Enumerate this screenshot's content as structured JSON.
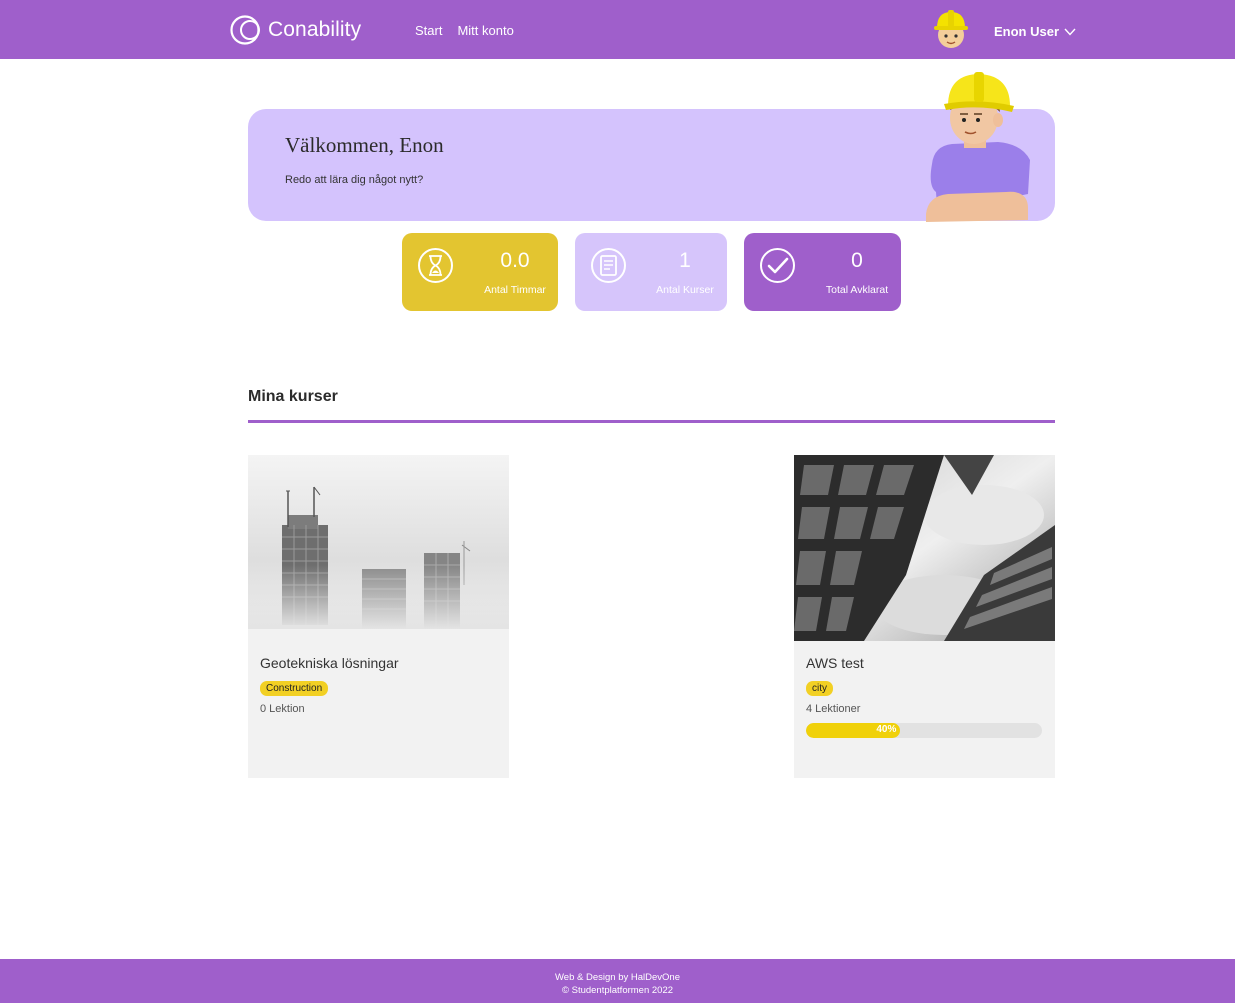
{
  "header": {
    "brand": "Conability",
    "nav": [
      "Start",
      "Mitt konto"
    ],
    "user_name": "Enon User",
    "avatar_icon": "construction-worker-avatar",
    "dropdown_icon": "chevron-down-icon"
  },
  "welcome": {
    "title": "Välkommen, Enon",
    "subtitle": "Redo att lära dig något nytt?"
  },
  "stats": [
    {
      "value": "0.0",
      "label": "Antal Timmar",
      "icon": "hourglass-icon",
      "color": "#e3c530"
    },
    {
      "value": "1",
      "label": "Antal Kurser",
      "icon": "book-icon",
      "color": "#d6c5fb"
    },
    {
      "value": "0",
      "label": "Total Avklarat",
      "icon": "checkmark-icon",
      "color": "#9f5fcb"
    }
  ],
  "section": {
    "title": "Mina kurser"
  },
  "courses": [
    {
      "title": "Geotekniska lösningar",
      "tag": "Construction",
      "lessons": "0 Lektion",
      "image": "foggy-construction-skyline"
    },
    {
      "title": "AWS test",
      "tag": "city",
      "lessons": "4 Lektioner",
      "progress": 0.4,
      "progress_label": "40%",
      "image": "skyscraper-low-angle"
    }
  ],
  "footer": {
    "line1": "Web & Design by HalDevOne",
    "line2": "© Studentplatformen 2022"
  },
  "colors": {
    "brand_purple": "#9f5fcb",
    "banner_lavender": "#d4c3fd",
    "accent_yellow": "#e3c530",
    "card_bg": "#f2f2f2"
  }
}
